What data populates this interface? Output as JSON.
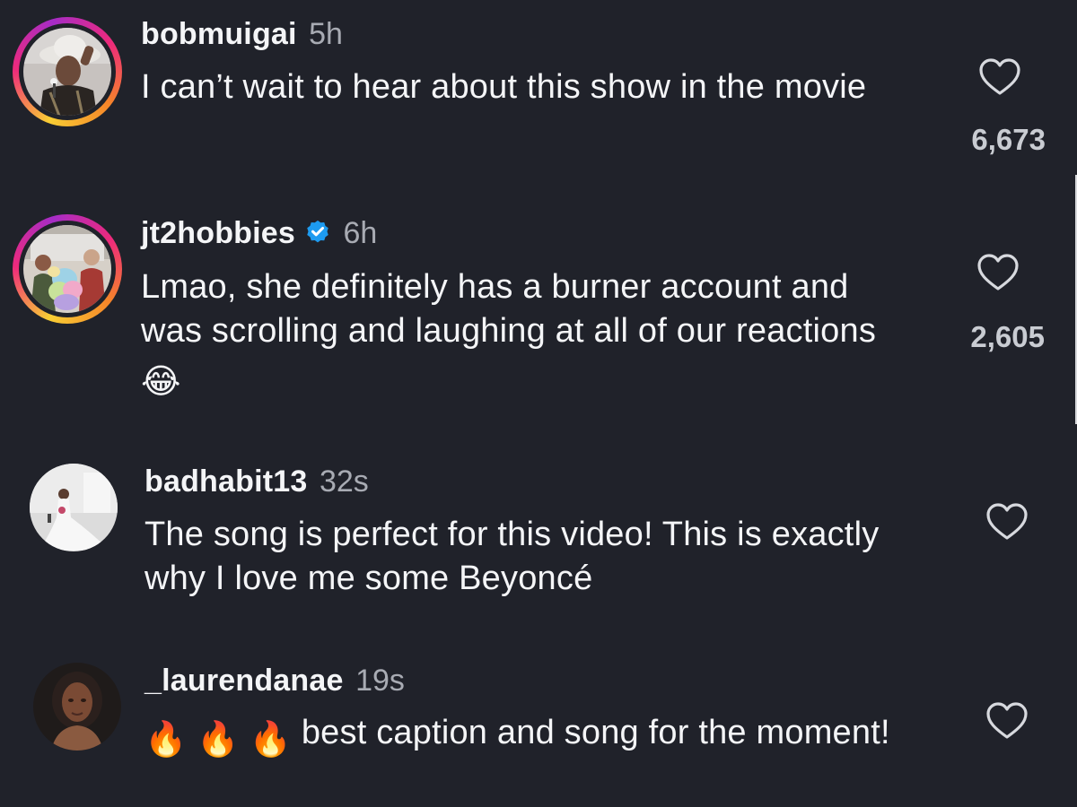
{
  "comments": [
    {
      "username": "bobmuigai",
      "time": "5h",
      "verified": false,
      "text": "I can’t wait to hear about this show in the movie",
      "likes": "6,673",
      "avatar_icon": "man-with-hat-and-microphone-avatar",
      "story_ring": true
    },
    {
      "username": "jt2hobbies",
      "time": "6h",
      "verified": true,
      "text": "Lmao, she definitely has a burner account and was scrolling and laughing at all of our reactions",
      "emoji": "😂",
      "likes": "2,605",
      "avatar_icon": "people-with-plush-toys-avatar",
      "story_ring": true
    },
    {
      "username": "badhabit13",
      "time": "32s",
      "verified": false,
      "text": "The song is perfect for this video! This is exactly why I love me some Beyoncé",
      "likes": "",
      "avatar_icon": "bride-in-white-dress-avatar",
      "story_ring": false
    },
    {
      "username": "_laurendanae",
      "time": "19s",
      "verified": false,
      "emoji": "🔥 🔥 🔥",
      "text": "best caption and song for the moment!",
      "likes": "",
      "avatar_icon": "woman-portrait-avatar",
      "story_ring": false
    }
  ],
  "colors": {
    "background": "#20222a",
    "text": "#f4f5f7",
    "secondary_text": "#a8abb3",
    "verified_badge": "#1d9bf0",
    "story_ring": [
      "#f9ce34",
      "#ee2a7b",
      "#a62cc7"
    ]
  }
}
